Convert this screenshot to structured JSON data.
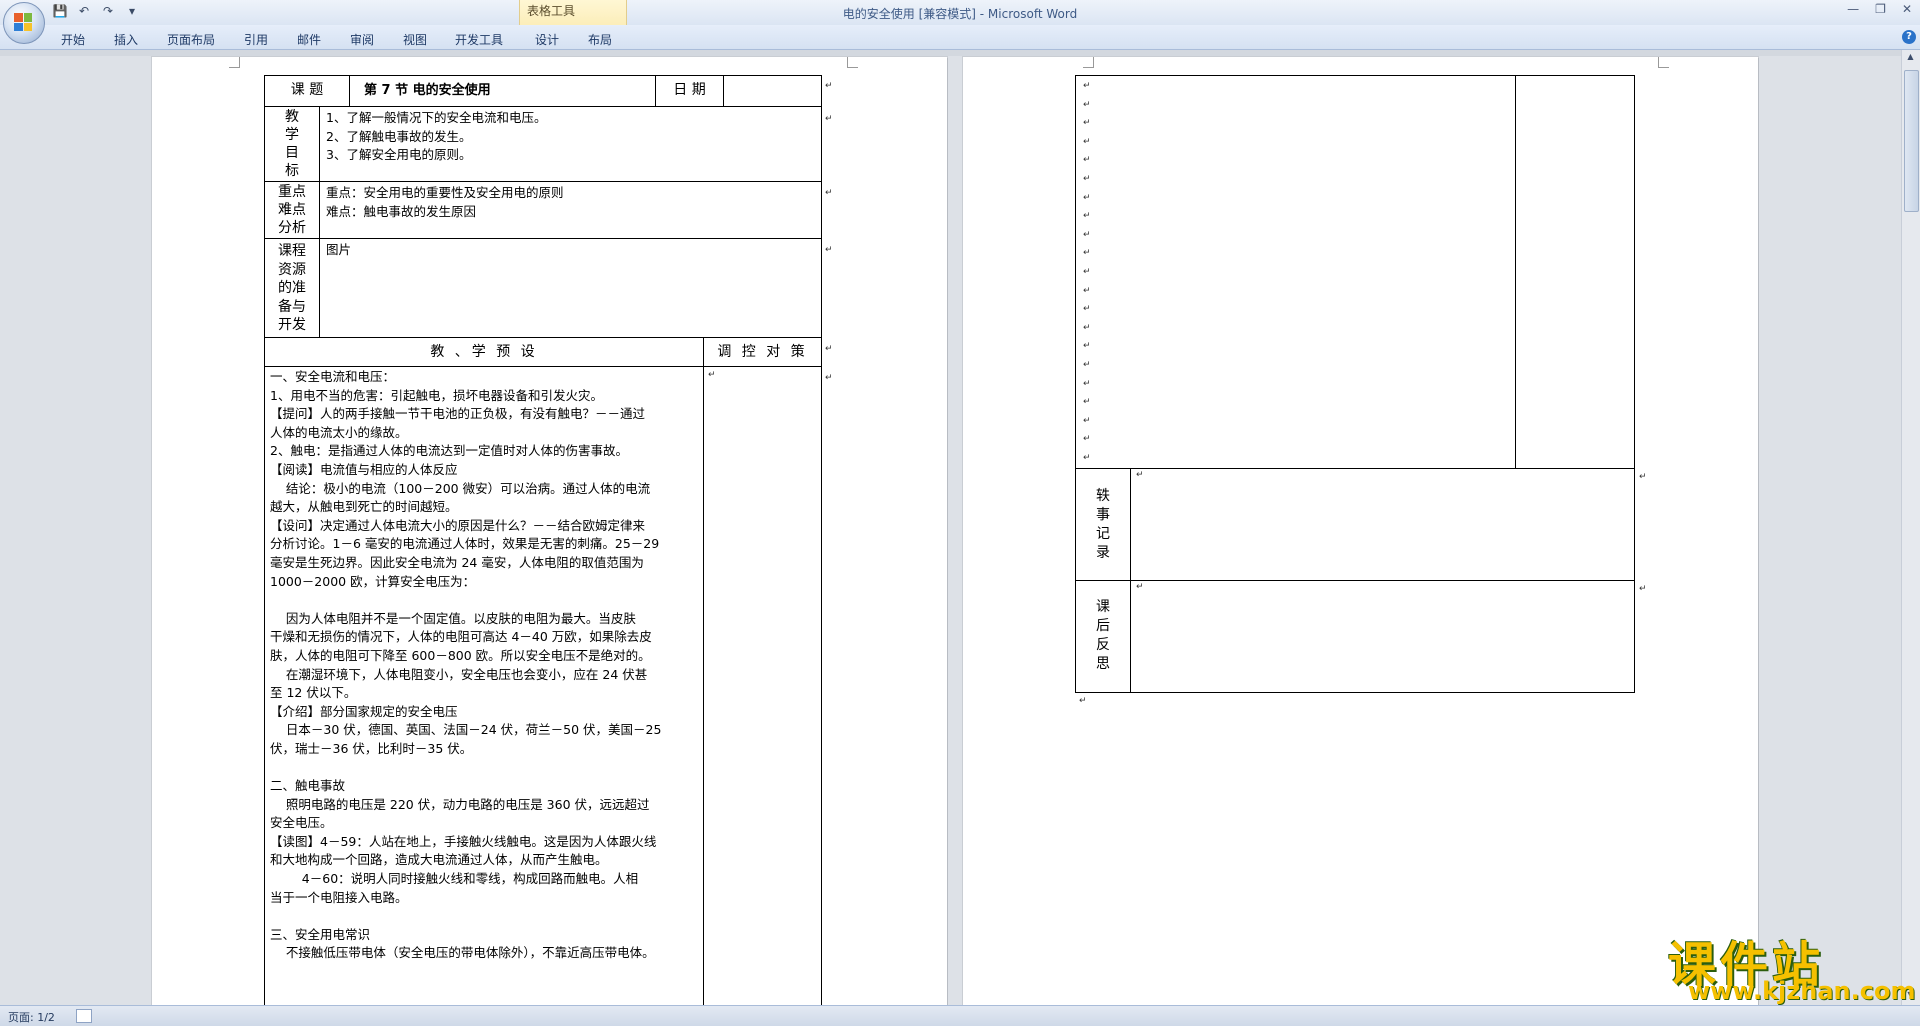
{
  "window": {
    "title": "电的安全使用 [兼容模式] - Microsoft Word",
    "context_group": "表格工具"
  },
  "ribbon": {
    "tabs": [
      "开始",
      "插入",
      "页面布局",
      "引用",
      "邮件",
      "审阅",
      "视图",
      "开发工具",
      "设计",
      "布局"
    ]
  },
  "icons": {
    "office_button": "office-logo-icon",
    "save": "save-icon",
    "undo": "undo-icon",
    "redo": "redo-icon",
    "customize": "dropdown-icon",
    "help": "help-icon"
  },
  "page1": {
    "lesson_label": "课 题",
    "lesson_title": "第 7 节 电的安全使用",
    "date_label": "日 期",
    "date_value": "",
    "goals_label": "教\n学\n目\n标",
    "goals": "1、了解一般情况下的安全电流和电压。\n2、了解触电事故的发生。\n3、了解安全用电的原则。",
    "keypoints_label": "重点\n难点\n分析",
    "keypoints": "重点：安全用电的重要性及安全用电的原则\n难点：触电事故的发生原因",
    "resources_label": "课程\n资源\n的准\n备与\n开发",
    "resources": "图片",
    "preset_label": "教 、学 预 设",
    "control_label": "调 控 对 策",
    "body": "一、安全电流和电压：\n1、用电不当的危害：引起触电，损坏电器设备和引发火灾。\n【提问】人的两手接触一节干电池的正负极，有没有触电？－－通过\n人体的电流太小的缘故。\n2、触电：是指通过人体的电流达到一定值时对人体的伤害事故。\n【阅读】电流值与相应的人体反应\n    结论：极小的电流（100－200 微安）可以治病。通过人体的电流\n越大，从触电到死亡的时间越短。\n【设问】决定通过人体电流大小的原因是什么？－－结合欧姆定律来\n分析讨论。1－6 毫安的电流通过人体时，效果是无害的刺痛。25－29\n毫安是生死边界。因此安全电流为 24 毫安，人体电阻的取值范围为\n1000－2000 欧，计算安全电压为：\n\n    因为人体电阻并不是一个固定值。以皮肤的电阻为最大。当皮肤\n干燥和无损伤的情况下，人体的电阻可高达 4－40 万欧，如果除去皮\n肤，人体的电阻可下降至 600－800 欧。所以安全电压不是绝对的。\n    在潮湿环境下，人体电阻变小，安全电压也会变小，应在 24 伏甚\n至 12 伏以下。\n【介绍】部分国家规定的安全电压\n    日本－30 伏，德国、英国、法国－24 伏，荷兰－50 伏，美国－25\n伏，瑞士－36 伏，比利时－35 伏。\n\n二、触电事故\n    照明电路的电压是 220 伏，动力电路的电压是 360 伏，远远超过\n安全电压。\n【读图】4－59：人站在地上，手接触火线触电。这是因为人体跟火线\n和大地构成一个回路，造成大电流通过人体，从而产生触电。\n        4－60：说明人同时接触火线和零线，构成回路而触电。人相\n当于一个电阻接入电路。\n\n三、安全用电常识\n    不接触低压带电体（安全电压的带电体除外），不靠近高压带电体。"
  },
  "page2": {
    "anecdote_label": "轶\n事\n记\n录",
    "reflection_label": "课\n后\n反\n思"
  },
  "status": {
    "page_info": "页面: 1/2"
  },
  "watermark": {
    "main": "课件站",
    "url": "www.kjzhan.com"
  },
  "colors": {
    "ribbon_bg": "#dbe5f3",
    "context_tab": "#fbecb5",
    "workspace": "#dde1e7",
    "watermark_fill": "#f5c000",
    "watermark_outline": "#2b5d0e"
  }
}
